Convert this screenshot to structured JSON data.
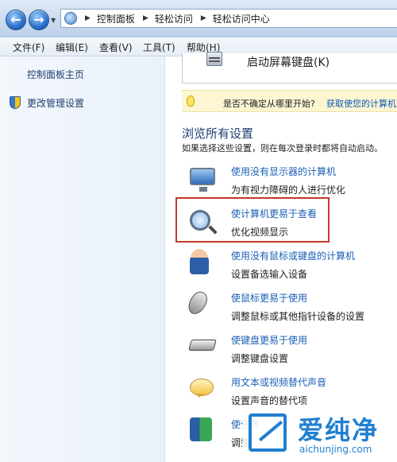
{
  "address_bar": {
    "breadcrumbs": [
      "控制面板",
      "轻松访问",
      "轻松访问中心"
    ]
  },
  "menu": [
    "文件(F)",
    "编辑(E)",
    "查看(V)",
    "工具(T)",
    "帮助(H)"
  ],
  "left_pane": {
    "home_link": "控制面板主页",
    "admin_link": "更改管理设置"
  },
  "right_pane": {
    "osk_label": "启动屏幕键盘(K)",
    "hint_text": "是否不确定从哪里开始?",
    "hint_link": "获取使您的计算机更",
    "section_title": "浏览所有设置",
    "section_desc": "如果选择这些设置，则在每次登录时都将自动启动。",
    "items": [
      {
        "link": "使用没有显示器的计算机",
        "desc": "为有视力障碍的人进行优化",
        "icon": "monitor-icon"
      },
      {
        "link": "使计算机更易于查看",
        "desc": "优化视频显示",
        "icon": "magnifier-icon"
      },
      {
        "link": "使用没有鼠标或键盘的计算机",
        "desc": "设置备选输入设备",
        "icon": "person-icon"
      },
      {
        "link": "使鼠标更易于使用",
        "desc": "调整鼠标或其他指针设备的设置",
        "icon": "mouse-icon"
      },
      {
        "link": "使键盘更易于使用",
        "desc": "调整键盘设置",
        "icon": "keyboard-icon"
      },
      {
        "link": "用文本或视频替代声音",
        "desc": "设置声音的替代项",
        "icon": "speech-bubble-icon"
      },
      {
        "link": "使任务",
        "desc": "调整",
        "icon": "task-icon"
      }
    ]
  },
  "watermark": {
    "cn": "爱纯净",
    "en": "aichunjing.com"
  }
}
